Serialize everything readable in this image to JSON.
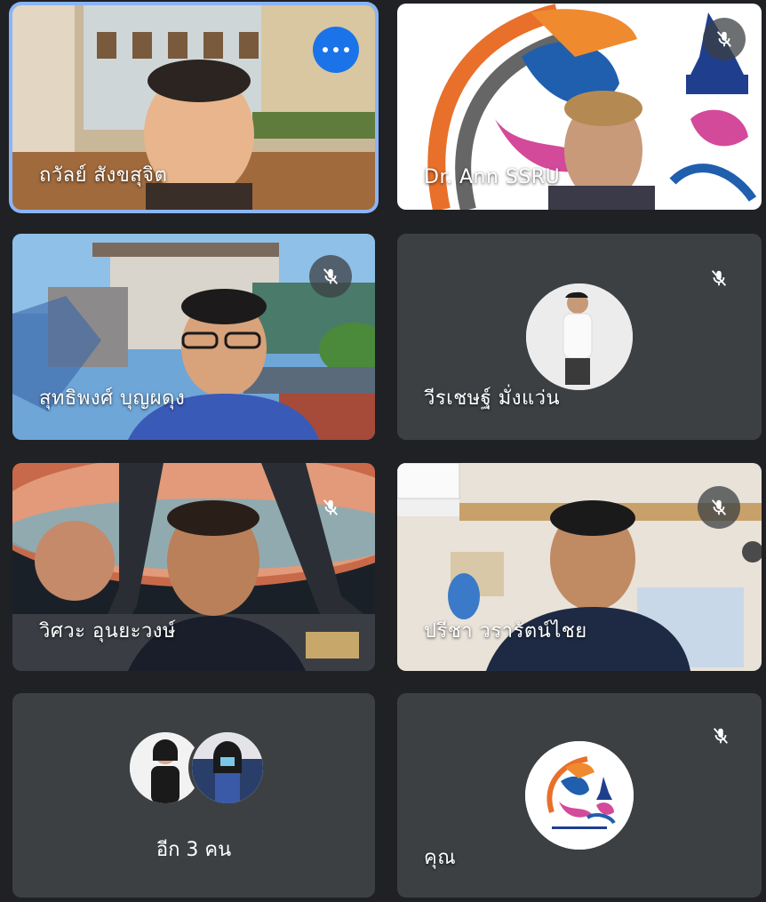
{
  "participants": [
    {
      "name": "ถวัลย์ สังขสุจิต",
      "active": true,
      "more_button": "more-options"
    },
    {
      "name": "Dr. Ann SSRU",
      "muted": true
    },
    {
      "name": "สุทธิพงศ์ บุญผดุง",
      "muted": true
    },
    {
      "name": "วีรเชษฐ์ มั่งแว่น",
      "muted": true
    },
    {
      "name": "วิศวะ อุนยะวงษ์",
      "muted": true
    },
    {
      "name": "ปรีชา วรารัตน์ไชย",
      "muted": true
    },
    {
      "name": "อีก 3 คน"
    },
    {
      "name": "คุณ",
      "muted": true
    }
  ],
  "colors": {
    "background": "#202124",
    "tile": "#3c4043",
    "active_border": "#8ab4f8",
    "more_button": "#1a73e8"
  },
  "icons": [
    "more-options-icon",
    "mic-off-icon"
  ]
}
